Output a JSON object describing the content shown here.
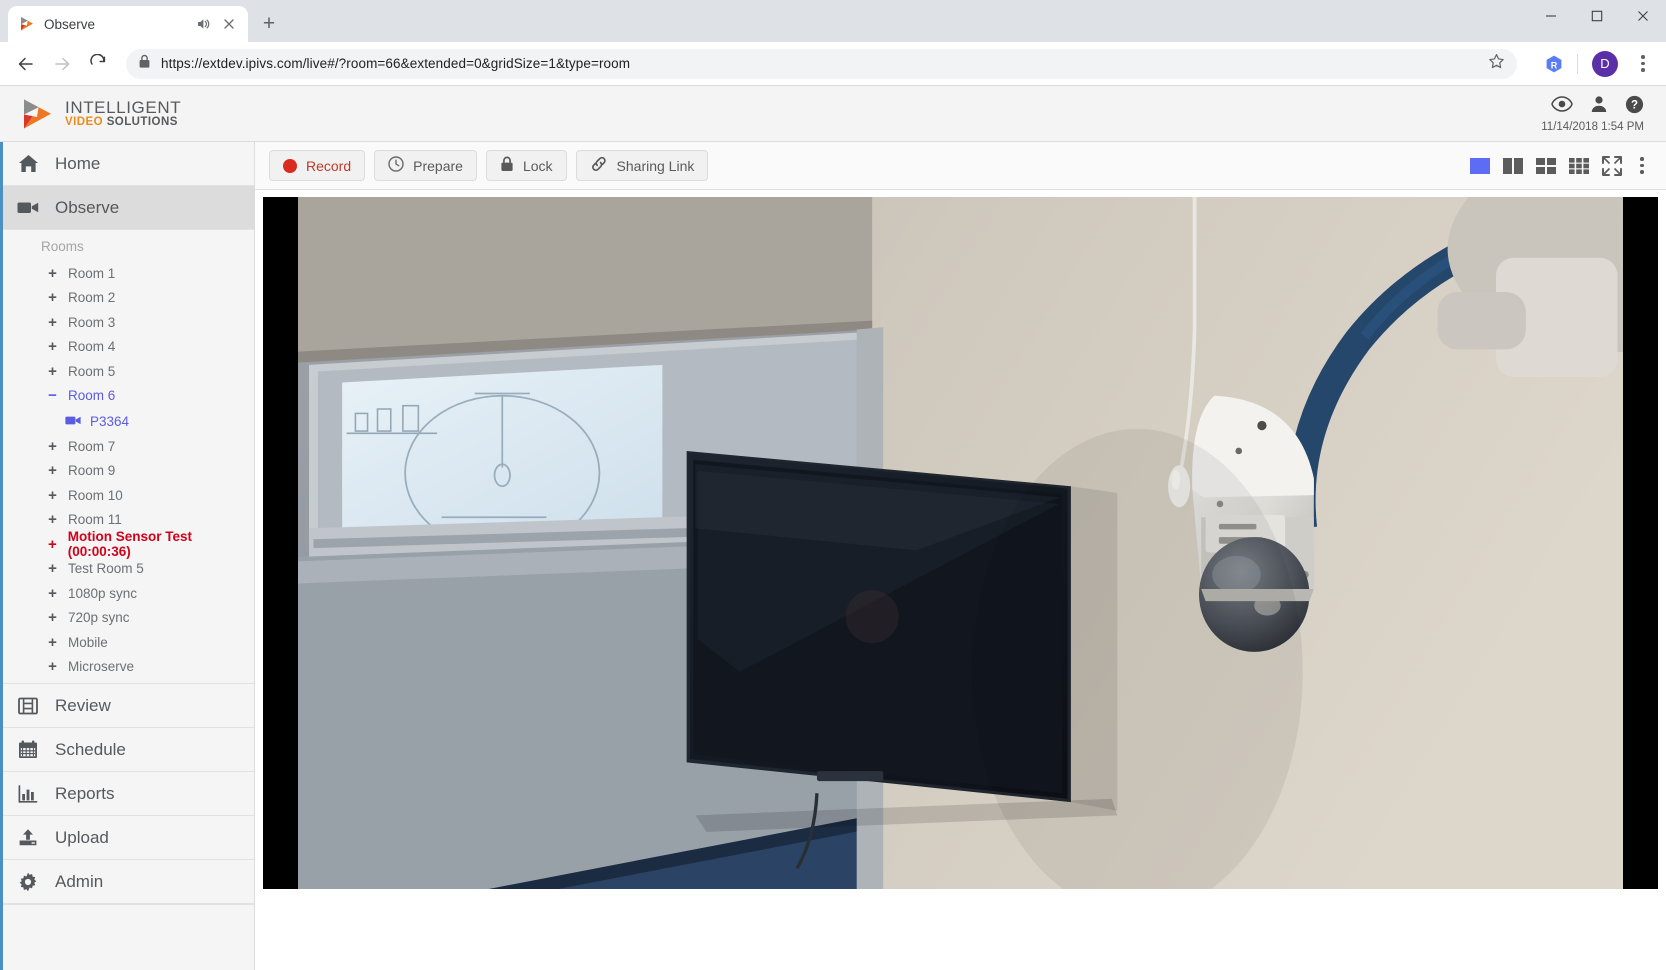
{
  "browser": {
    "tab": {
      "title": "Observe",
      "favicon": "ivs-play-icon",
      "audio_icon": "speaker-icon",
      "close_icon": "close-icon"
    },
    "new_tab_label": "+",
    "window_controls": {
      "minimize": "−",
      "maximize": "□",
      "close": "✕"
    },
    "nav": {
      "back": "←",
      "forward": "→",
      "reload": "⟳"
    },
    "omnibox": {
      "lock_icon": "lock-icon",
      "url": "https://extdev.ipivs.com/live#/?room=66&extended=0&gridSize=1&type=room",
      "scheme": "https://",
      "host": "extdev.ipivs.com",
      "path": "/live#/?room=66&extended=0&gridSize=1&type=room",
      "star_icon": "star-icon"
    },
    "extension_badge": "R",
    "profile_initial": "D",
    "menu_icon": "kebab-menu-icon"
  },
  "header": {
    "logo": {
      "line1": "INTELLIGENT",
      "video": "VIDEO",
      "solutions": " SOLUTIONS"
    },
    "icons": [
      {
        "name": "eye-icon",
        "label": "Observe"
      },
      {
        "name": "user-icon",
        "label": "Account"
      },
      {
        "name": "help-icon",
        "label": "Help"
      }
    ],
    "datetime": "11/14/2018 1:54 PM"
  },
  "sidebar": {
    "items": [
      {
        "label": "Home",
        "icon": "home-icon",
        "active": false
      },
      {
        "label": "Observe",
        "icon": "video-camera-icon",
        "active": true
      }
    ],
    "rooms_label": "Rooms",
    "rooms": [
      {
        "label": "Room 1",
        "toggle": "+",
        "state": "collapsed"
      },
      {
        "label": "Room 2",
        "toggle": "+",
        "state": "collapsed"
      },
      {
        "label": "Room 3",
        "toggle": "+",
        "state": "collapsed"
      },
      {
        "label": "Room 4",
        "toggle": "+",
        "state": "collapsed"
      },
      {
        "label": "Room 5",
        "toggle": "+",
        "state": "collapsed"
      },
      {
        "label": "Room 6",
        "toggle": "−",
        "state": "expanded-selected"
      },
      {
        "label": "Room 7",
        "toggle": "+",
        "state": "collapsed"
      },
      {
        "label": "Room 9",
        "toggle": "+",
        "state": "collapsed"
      },
      {
        "label": "Room 10",
        "toggle": "+",
        "state": "collapsed"
      },
      {
        "label": "Room 11",
        "toggle": "+",
        "state": "collapsed"
      },
      {
        "label": "Motion Sensor Test (00:00:36)",
        "toggle": "+",
        "state": "recording"
      },
      {
        "label": "Test Room 5",
        "toggle": "+",
        "state": "collapsed"
      },
      {
        "label": "1080p sync",
        "toggle": "+",
        "state": "collapsed"
      },
      {
        "label": "720p sync",
        "toggle": "+",
        "state": "collapsed"
      },
      {
        "label": "Mobile",
        "toggle": "+",
        "state": "collapsed"
      },
      {
        "label": "Microserve",
        "toggle": "+",
        "state": "collapsed"
      }
    ],
    "camera": {
      "label": "P3364",
      "icon": "video-camera-icon"
    },
    "bottom_items": [
      {
        "label": "Review",
        "icon": "film-icon"
      },
      {
        "label": "Schedule",
        "icon": "calendar-icon"
      },
      {
        "label": "Reports",
        "icon": "bar-chart-icon"
      },
      {
        "label": "Upload",
        "icon": "upload-icon"
      },
      {
        "label": "Admin",
        "icon": "gear-icon"
      }
    ]
  },
  "toolbar": {
    "buttons": [
      {
        "label": "Record",
        "icon": "record-dot-icon",
        "style": "record"
      },
      {
        "label": "Prepare",
        "icon": "clock-icon",
        "style": "normal"
      },
      {
        "label": "Lock",
        "icon": "lock-icon",
        "style": "normal"
      },
      {
        "label": "Sharing Link",
        "icon": "link-icon",
        "style": "normal"
      }
    ],
    "grid_options": [
      {
        "name": "grid-1x1",
        "active": true
      },
      {
        "name": "grid-2-column",
        "active": false
      },
      {
        "name": "grid-2x2",
        "active": false
      },
      {
        "name": "grid-3x3",
        "active": false
      },
      {
        "name": "fullscreen-expand",
        "active": false
      }
    ],
    "overflow_icon": "vertical-dots-icon",
    "active_grid_color": "#5c6cf5"
  },
  "video": {
    "description": "Live camera view of a conference room wall with a wall-mounted flat screen TV, a white PTZ dome camera, a hanging microphone, and a window showing a whiteboard with sketches",
    "letterbox_color": "#000000"
  }
}
